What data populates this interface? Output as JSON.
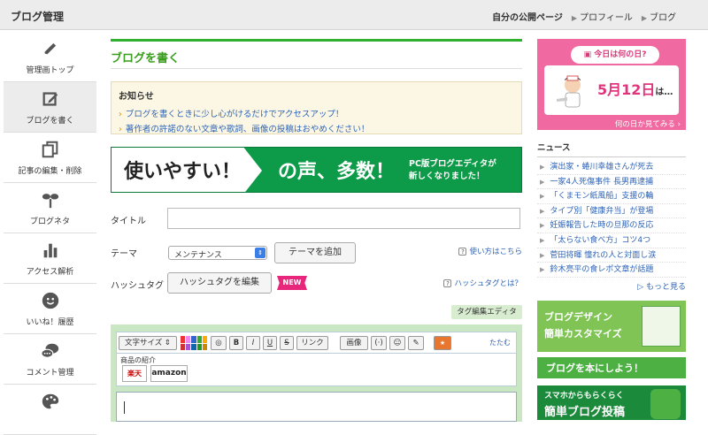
{
  "header": {
    "brand": "ブログ管理",
    "links": [
      "自分の公開ページ",
      "プロフィール",
      "ブログ"
    ]
  },
  "sidebar": {
    "items": [
      {
        "label": "管理画トップ",
        "icon": "pen-icon"
      },
      {
        "label": "ブログを書く",
        "icon": "edit-icon",
        "active": true
      },
      {
        "label": "記事の編集・削除",
        "icon": "pages-icon"
      },
      {
        "label": "ブログネタ",
        "icon": "sprout-icon"
      },
      {
        "label": "アクセス解析",
        "icon": "bar-chart-icon"
      },
      {
        "label": "いいね！履歴",
        "icon": "smiley-icon"
      },
      {
        "label": "コメント管理",
        "icon": "chat-icon"
      },
      {
        "label": "",
        "icon": "palette-icon"
      }
    ]
  },
  "main": {
    "title": "ブログを書く",
    "notice": {
      "heading": "お知らせ",
      "items": [
        "ブログを書くときに少し心がけるだけでアクセスアップ！",
        "著作者の許諾のない文章や歌詞、画像の投稿はおやめください！"
      ]
    },
    "banner": {
      "left": "使いやすい！",
      "middle": "の声、多数！",
      "right_line1": "PC版ブログエディタが",
      "right_line2": "新しくなりました！"
    },
    "form": {
      "title_label": "タイトル",
      "title_value": "",
      "theme_label": "テーマ",
      "theme_value": "メンテナンス",
      "add_theme": "テーマを追加",
      "howto": "使い方はこちら",
      "hashtag_label": "ハッシュタグ",
      "hashtag_button": "ハッシュタグを編集",
      "new_badge": "NEW",
      "hashtag_help": "ハッシュタグとは？"
    },
    "editor": {
      "tab": "タグ編集エディタ",
      "font_size": "文字サイズ",
      "bold": "B",
      "italic": "I",
      "underline": "U",
      "strike": "S",
      "link": "リンク",
      "image": "画像",
      "fold": "たたむ",
      "product_label": "商品の紹介",
      "rakuten": "楽天",
      "amazon": "amazon",
      "body": ""
    }
  },
  "right": {
    "today": {
      "pill": "今日は何の日?",
      "date_num": "5月12日",
      "date_suffix": "は…",
      "footer": "何の日か見てみる ›"
    },
    "news": {
      "heading": "ニュース",
      "items": [
        "演出家・蜷川幸雄さんが死去",
        "一家4人死傷事件 長男再逮捕",
        "「くまモン紙風船」支援の輪",
        "タイプ別「健康弁当」が登場",
        "妊娠報告した時の旦那の反応",
        "「太らない食べ方」コツ4つ",
        "菅田将暉 憧れの人と対面し涙",
        "鈴木亮平の食レポ文章が話題"
      ],
      "more": "もっと見る"
    },
    "ads": {
      "design_line1": "ブログデザイン",
      "design_line2": "簡単カスタマイズ",
      "book": "ブログを本にしよう！",
      "smartphone_line1": "スマホからもらくらく",
      "smartphone_line2": "簡単ブログ投稿"
    }
  },
  "colors": {
    "accent_green": "#2fb12f",
    "link_blue": "#2f64b5",
    "pink": "#f06aa1"
  }
}
